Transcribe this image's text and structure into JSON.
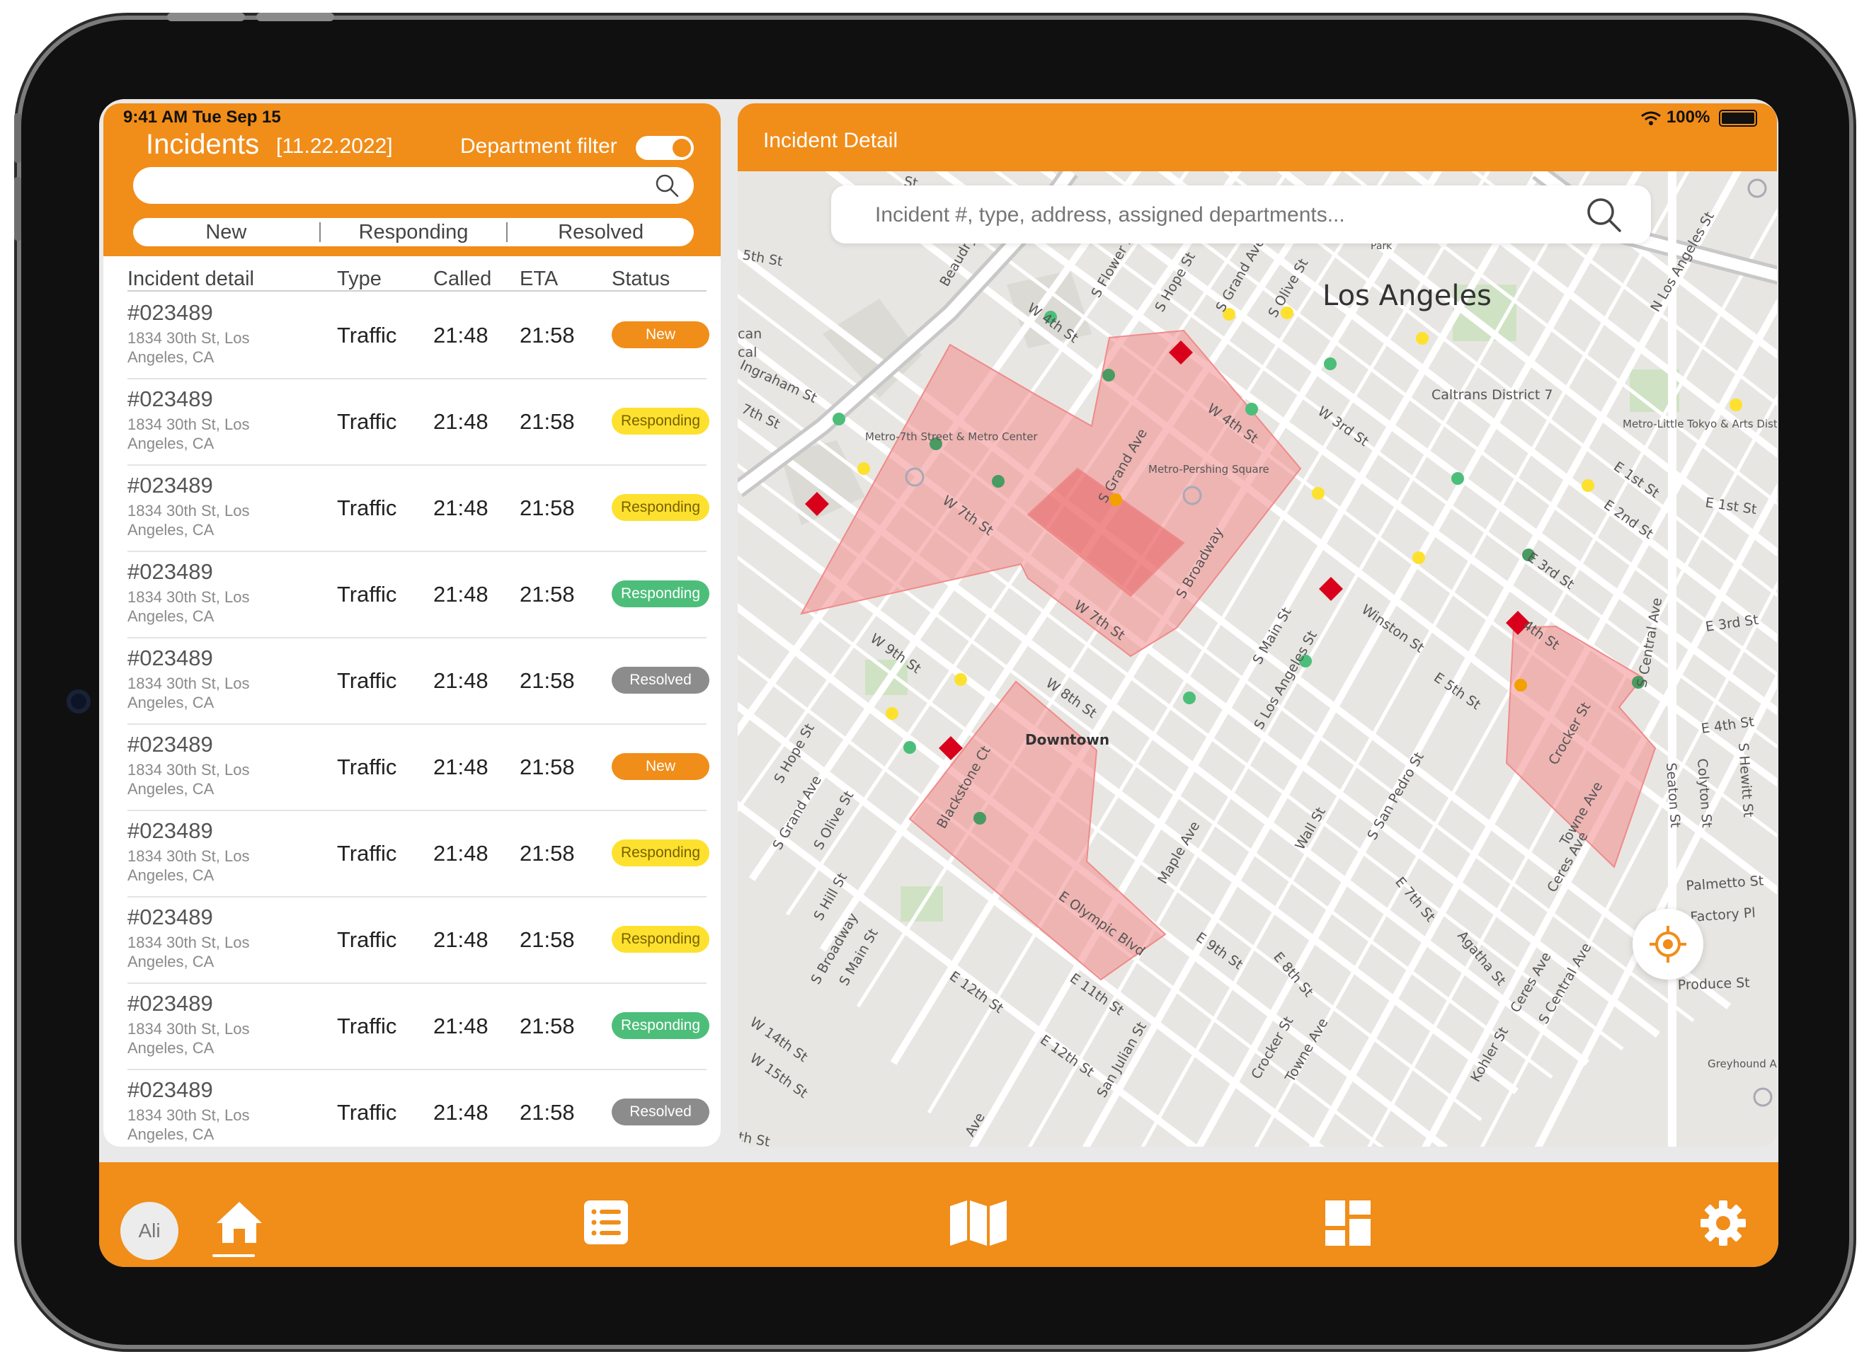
{
  "status_bar": {
    "time": "9:41 AM   Tue Sep 15",
    "battery": "100%"
  },
  "incidents_panel": {
    "title": "Incidents",
    "date": "[11.22.2022]",
    "filter_label": "Department filter",
    "filter_on": true,
    "search_value": "",
    "tabs": [
      "New",
      "Responding",
      "Resolved"
    ],
    "columns": [
      "Incident detail",
      "Type",
      "Called",
      "ETA",
      "Status"
    ],
    "rows": [
      {
        "id": "#023489",
        "address": "1834 30th St, Los Angeles, CA",
        "type": "Traffic",
        "called": "21:48",
        "eta": "21:58",
        "status": "New"
      },
      {
        "id": "#023489",
        "address": "1834 30th St, Los Angeles, CA",
        "type": "Traffic",
        "called": "21:48",
        "eta": "21:58",
        "status": "Responding"
      },
      {
        "id": "#023489",
        "address": "1834 30th St, Los Angeles, CA",
        "type": "Traffic",
        "called": "21:48",
        "eta": "21:58",
        "status": "Responding"
      },
      {
        "id": "#023489",
        "address": "1834 30th St, Los Angeles, CA",
        "type": "Traffic",
        "called": "21:48",
        "eta": "21:58",
        "status": "Responding"
      },
      {
        "id": "#023489",
        "address": "1834 30th St, Los Angeles, CA",
        "type": "Traffic",
        "called": "21:48",
        "eta": "21:58",
        "status": "Resolved"
      },
      {
        "id": "#023489",
        "address": "1834 30th St, Los Angeles, CA",
        "type": "Traffic",
        "called": "21:48",
        "eta": "21:58",
        "status": "New"
      },
      {
        "id": "#023489",
        "address": "1834 30th St, Los Angeles, CA",
        "type": "Traffic",
        "called": "21:48",
        "eta": "21:58",
        "status": "Responding"
      },
      {
        "id": "#023489",
        "address": "1834 30th St, Los Angeles, CA",
        "type": "Traffic",
        "called": "21:48",
        "eta": "21:58",
        "status": "Responding"
      },
      {
        "id": "#023489",
        "address": "1834 30th St, Los Angeles, CA",
        "type": "Traffic",
        "called": "21:48",
        "eta": "21:58",
        "status": "Responding"
      },
      {
        "id": "#023489",
        "address": "1834 30th St, Los Angeles, CA",
        "type": "Traffic",
        "called": "21:48",
        "eta": "21:58",
        "status": "Resolved"
      }
    ],
    "status_colors": [
      "new-orange",
      "responding-yellow",
      "responding-yellow",
      "responding-green",
      "resolved-gray",
      "new-orange",
      "responding-yellow",
      "responding-yellow",
      "responding-green",
      "resolved-gray"
    ]
  },
  "detail_panel": {
    "title": "Incident Detail",
    "search_placeholder": "Incident #, type, address, assigned departments...",
    "map": {
      "city_label": "Los Angeles",
      "labels": {
        "downtown": "Downtown",
        "caltrans": "Caltrans District 7",
        "metro7th": "Metro-7th Street & Metro Center",
        "pershing": "Metro-Pershing Square",
        "little_tokyo": "Metro-Little Tokyo & Arts District",
        "greyhound": "Greyhound Angeles",
        "park": "Park"
      },
      "streets": [
        "W 4th St",
        "S Flower St",
        "S Hope St",
        "S Grand Ave",
        "S Olive St",
        "W 3rd St",
        "N Los Angeles St",
        "Ingraham St",
        "7th St",
        "S Grand Ave",
        "W 4th St",
        "W 7th St",
        "S Broadway",
        "W 7th St",
        "W 9th St",
        "W 8th St",
        "E 1st St",
        "E 1st St",
        "E 2nd St",
        "E 3rd St",
        "E 3rd St",
        "E 4th St",
        "4th St",
        "E 5th St",
        "Winston St",
        "S Main St",
        "S Los Angeles St",
        "S Central Ave",
        "Crocker St",
        "Towne Ave",
        "S San Pedro St",
        "Wall St",
        "Maple Ave",
        "S Hope St",
        "S Grand Ave",
        "S Olive St",
        "S Hill St",
        "S Broadway",
        "S Main St",
        "Blackstone Ct",
        "E Olympic Blvd",
        "E 12th St",
        "E 11th St",
        "E 12th St",
        "E 9th St",
        "E 8th St",
        "E 7th St",
        "Agatha St",
        "Ceres Ave",
        "Kohler St",
        "S Central Ave",
        "San Julian St",
        "Crocker St",
        "Towne Ave",
        "W 14th St",
        "W 15th St",
        "Seaton St",
        "Colyton St",
        "S Hewitt St",
        "Palmetto St",
        "Factory Pl",
        "Produce St",
        "Ave",
        "5th St",
        "Beaudry",
        "St",
        "can",
        "cal",
        "Ceres Ave",
        "th St"
      ]
    }
  },
  "nav": {
    "avatar": "Ali",
    "items": [
      "home-icon",
      "list-icon",
      "map-icon",
      "dashboard-icon",
      "settings-icon"
    ]
  },
  "colors": {
    "accent": "#f18d19",
    "new": "#f18d19",
    "responding_yellow": "#fde12e",
    "responding_green": "#4cbe7a",
    "resolved": "#8c8c8c",
    "zone": "#f08a8a",
    "incident_marker": "#d9001b"
  }
}
